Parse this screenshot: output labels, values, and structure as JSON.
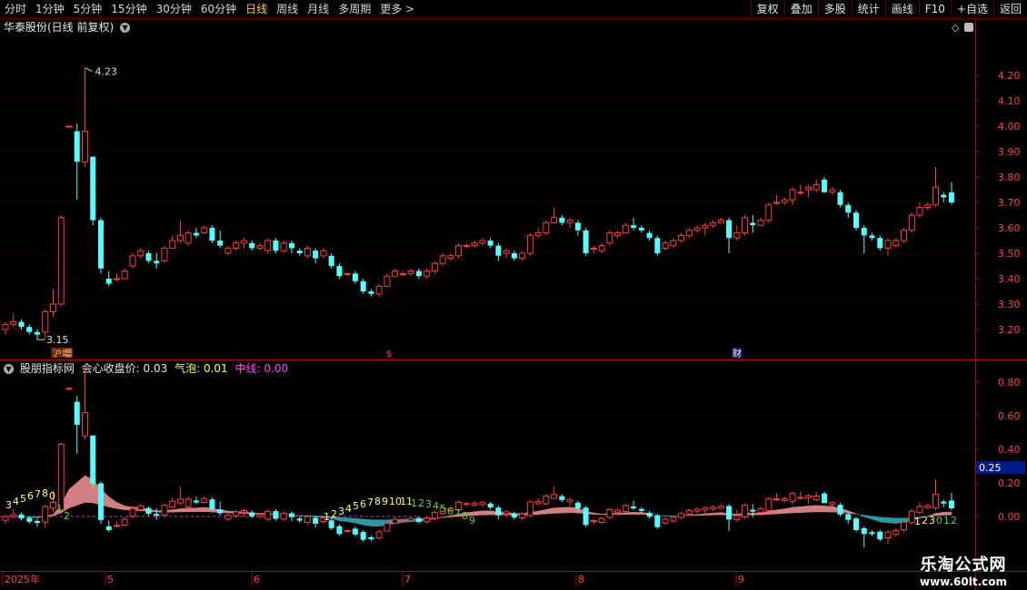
{
  "toolbar": {
    "periods": [
      "分时",
      "1分钟",
      "5分钟",
      "15分钟",
      "30分钟",
      "60分钟",
      "日线",
      "周线",
      "月线",
      "多周期",
      "更多 >"
    ],
    "active_period": "日线",
    "right_buttons": [
      "复权",
      "叠加",
      "多股",
      "统计",
      "画线",
      "F10",
      "+自选",
      "返回"
    ]
  },
  "main_chart": {
    "title": "华泰股份(日线 前复权)",
    "high_label": "4.23",
    "low_label": "3.15",
    "y_ticks": [
      "4.20",
      "4.10",
      "4.00",
      "3.90",
      "3.80",
      "3.70",
      "3.60",
      "3.50",
      "3.40",
      "3.30",
      "3.20"
    ],
    "markers": [
      "增",
      "$",
      "财"
    ]
  },
  "indicator": {
    "name": "股朋指标网",
    "label1": "会心收盘价:",
    "value1": "0.03",
    "label2": "气泡:",
    "value2": "0.01",
    "label3": "中线:",
    "value3": "0.00",
    "y_ticks": [
      "0.80",
      "0.60",
      "0.40",
      "0.20",
      "0.00"
    ],
    "current_value": "0.25",
    "count_labels": [
      "3",
      "4",
      "5",
      "6",
      "7",
      "8",
      "0",
      "1",
      "2",
      "1",
      "2",
      "3",
      "4",
      "5",
      "6",
      "7",
      "8",
      "9",
      "10",
      "11",
      "1",
      "2",
      "3",
      "4",
      "5",
      "6",
      "7",
      "8",
      "9",
      "1",
      "2",
      "3",
      "0",
      "1",
      "2"
    ]
  },
  "x_axis": {
    "labels": [
      "2025年",
      "5",
      "6",
      "7",
      "8",
      "9"
    ]
  },
  "colors": {
    "up": "#ff3d3d",
    "down": "#54ffff",
    "grid": "#7a0000",
    "ribbon_up": "#d08080",
    "ribbon_down": "#2a9aa0"
  },
  "watermark": {
    "title": "乐淘公式网",
    "url": "www.60lt.com"
  },
  "chart_data": {
    "type": "candlestick",
    "ylim": [
      3.12,
      4.27
    ],
    "candles": [
      [
        3.2,
        3.22,
        3.23,
        3.18
      ],
      [
        3.22,
        3.23,
        3.26,
        3.21
      ],
      [
        3.23,
        3.21,
        3.24,
        3.2
      ],
      [
        3.21,
        3.19,
        3.22,
        3.18
      ],
      [
        3.19,
        3.18,
        3.2,
        3.16
      ],
      [
        3.19,
        3.27,
        3.28,
        3.16
      ],
      [
        3.27,
        3.3,
        3.36,
        3.25
      ],
      [
        3.3,
        3.64,
        3.65,
        3.29
      ],
      [
        4.0,
        4.0,
        4.0,
        4.0
      ],
      [
        3.98,
        3.86,
        4.01,
        3.71
      ],
      [
        3.86,
        3.98,
        4.23,
        3.84
      ],
      [
        3.88,
        3.63,
        3.88,
        3.61
      ],
      [
        3.63,
        3.44,
        3.64,
        3.42
      ],
      [
        3.4,
        3.38,
        3.43,
        3.37
      ],
      [
        3.4,
        3.4,
        3.42,
        3.39
      ],
      [
        3.4,
        3.43,
        3.44,
        3.41
      ],
      [
        3.45,
        3.49,
        3.5,
        3.44
      ],
      [
        3.49,
        3.51,
        3.52,
        3.48
      ],
      [
        3.5,
        3.47,
        3.51,
        3.46
      ],
      [
        3.47,
        3.46,
        3.5,
        3.44
      ],
      [
        3.47,
        3.52,
        3.53,
        3.46
      ],
      [
        3.52,
        3.55,
        3.57,
        3.52
      ],
      [
        3.55,
        3.57,
        3.63,
        3.54
      ],
      [
        3.54,
        3.58,
        3.59,
        3.53
      ],
      [
        3.58,
        3.57,
        3.6,
        3.56
      ],
      [
        3.58,
        3.6,
        3.61,
        3.58
      ],
      [
        3.6,
        3.55,
        3.61,
        3.54
      ],
      [
        3.55,
        3.53,
        3.59,
        3.52
      ],
      [
        3.5,
        3.52,
        3.53,
        3.49
      ],
      [
        3.52,
        3.54,
        3.55,
        3.51
      ],
      [
        3.54,
        3.55,
        3.56,
        3.52
      ],
      [
        3.54,
        3.52,
        3.55,
        3.51
      ],
      [
        3.52,
        3.53,
        3.54,
        3.51
      ],
      [
        3.51,
        3.55,
        3.56,
        3.5
      ],
      [
        3.55,
        3.51,
        3.56,
        3.5
      ],
      [
        3.51,
        3.54,
        3.55,
        3.5
      ],
      [
        3.54,
        3.52,
        3.55,
        3.5
      ],
      [
        3.51,
        3.5,
        3.52,
        3.49
      ],
      [
        3.49,
        3.52,
        3.53,
        3.48
      ],
      [
        3.51,
        3.48,
        3.52,
        3.46
      ],
      [
        3.49,
        3.51,
        3.52,
        3.48
      ],
      [
        3.49,
        3.45,
        3.5,
        3.44
      ],
      [
        3.45,
        3.41,
        3.46,
        3.4
      ],
      [
        3.42,
        3.42,
        3.42,
        3.41
      ],
      [
        3.42,
        3.39,
        3.43,
        3.38
      ],
      [
        3.39,
        3.35,
        3.4,
        3.34
      ],
      [
        3.35,
        3.34,
        3.36,
        3.33
      ],
      [
        3.34,
        3.37,
        3.38,
        3.33
      ],
      [
        3.37,
        3.41,
        3.42,
        3.37
      ],
      [
        3.41,
        3.43,
        3.44,
        3.41
      ],
      [
        3.42,
        3.42,
        3.43,
        3.41
      ],
      [
        3.42,
        3.43,
        3.44,
        3.41
      ],
      [
        3.43,
        3.41,
        3.44,
        3.4
      ],
      [
        3.41,
        3.43,
        3.44,
        3.4
      ],
      [
        3.43,
        3.46,
        3.47,
        3.42
      ],
      [
        3.46,
        3.49,
        3.5,
        3.45
      ],
      [
        3.48,
        3.49,
        3.5,
        3.47
      ],
      [
        3.49,
        3.53,
        3.54,
        3.48
      ],
      [
        3.53,
        3.53,
        3.54,
        3.52
      ],
      [
        3.53,
        3.54,
        3.55,
        3.52
      ],
      [
        3.54,
        3.55,
        3.56,
        3.53
      ],
      [
        3.55,
        3.53,
        3.56,
        3.52
      ],
      [
        3.53,
        3.49,
        3.54,
        3.47
      ],
      [
        3.5,
        3.51,
        3.52,
        3.48
      ],
      [
        3.5,
        3.48,
        3.51,
        3.47
      ],
      [
        3.48,
        3.5,
        3.51,
        3.47
      ],
      [
        3.5,
        3.57,
        3.58,
        3.49
      ],
      [
        3.57,
        3.58,
        3.6,
        3.56
      ],
      [
        3.58,
        3.62,
        3.63,
        3.57
      ],
      [
        3.62,
        3.64,
        3.68,
        3.63
      ],
      [
        3.64,
        3.62,
        3.65,
        3.61
      ],
      [
        3.62,
        3.63,
        3.64,
        3.6
      ],
      [
        3.62,
        3.59,
        3.63,
        3.57
      ],
      [
        3.59,
        3.5,
        3.6,
        3.49
      ],
      [
        3.52,
        3.52,
        3.53,
        3.5
      ],
      [
        3.51,
        3.53,
        3.54,
        3.5
      ],
      [
        3.54,
        3.58,
        3.59,
        3.53
      ],
      [
        3.57,
        3.58,
        3.59,
        3.56
      ],
      [
        3.58,
        3.61,
        3.62,
        3.58
      ],
      [
        3.61,
        3.6,
        3.64,
        3.59
      ],
      [
        3.6,
        3.59,
        3.61,
        3.58
      ],
      [
        3.58,
        3.56,
        3.59,
        3.55
      ],
      [
        3.56,
        3.5,
        3.57,
        3.49
      ],
      [
        3.52,
        3.54,
        3.55,
        3.51
      ],
      [
        3.53,
        3.55,
        3.56,
        3.52
      ],
      [
        3.55,
        3.57,
        3.58,
        3.54
      ],
      [
        3.57,
        3.59,
        3.6,
        3.56
      ],
      [
        3.59,
        3.6,
        3.61,
        3.58
      ],
      [
        3.6,
        3.61,
        3.62,
        3.57
      ],
      [
        3.61,
        3.62,
        3.63,
        3.6
      ],
      [
        3.62,
        3.63,
        3.64,
        3.62
      ],
      [
        3.63,
        3.56,
        3.64,
        3.5
      ],
      [
        3.56,
        3.58,
        3.61,
        3.55
      ],
      [
        3.58,
        3.64,
        3.65,
        3.57
      ],
      [
        3.62,
        3.61,
        3.65,
        3.58
      ],
      [
        3.61,
        3.63,
        3.64,
        3.62
      ],
      [
        3.63,
        3.69,
        3.7,
        3.62
      ],
      [
        3.7,
        3.7,
        3.73,
        3.69
      ],
      [
        3.7,
        3.71,
        3.72,
        3.69
      ],
      [
        3.71,
        3.75,
        3.76,
        3.69
      ],
      [
        3.74,
        3.74,
        3.77,
        3.73
      ],
      [
        3.75,
        3.76,
        3.77,
        3.72
      ],
      [
        3.75,
        3.77,
        3.79,
        3.74
      ],
      [
        3.79,
        3.74,
        3.8,
        3.74
      ],
      [
        3.74,
        3.75,
        3.76,
        3.73
      ],
      [
        3.74,
        3.69,
        3.75,
        3.68
      ],
      [
        3.69,
        3.66,
        3.7,
        3.64
      ],
      [
        3.66,
        3.6,
        3.67,
        3.59
      ],
      [
        3.6,
        3.57,
        3.61,
        3.5
      ],
      [
        3.57,
        3.56,
        3.58,
        3.55
      ],
      [
        3.56,
        3.52,
        3.57,
        3.51
      ],
      [
        3.52,
        3.55,
        3.56,
        3.49
      ],
      [
        3.53,
        3.55,
        3.56,
        3.52
      ],
      [
        3.55,
        3.59,
        3.6,
        3.54
      ],
      [
        3.59,
        3.65,
        3.66,
        3.58
      ],
      [
        3.65,
        3.68,
        3.7,
        3.64
      ],
      [
        3.68,
        3.69,
        3.7,
        3.67
      ],
      [
        3.69,
        3.76,
        3.84,
        3.68
      ],
      [
        3.73,
        3.72,
        3.74,
        3.7
      ],
      [
        3.74,
        3.7,
        3.78,
        3.69
      ]
    ]
  }
}
